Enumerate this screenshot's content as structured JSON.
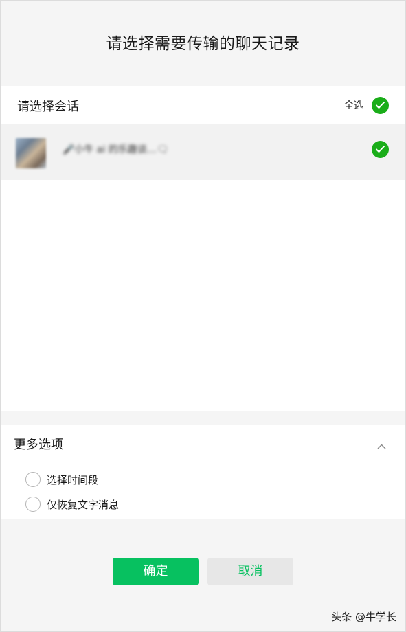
{
  "dialog": {
    "title": "请选择需要传输的聊天记录"
  },
  "sessions": {
    "header_label": "请选择会话",
    "select_all_label": "全选",
    "items": [
      {
        "name": "🎤小牛 ai 的乐趣谈…🗨"
      }
    ]
  },
  "more_options": {
    "header": "更多选项",
    "options": [
      {
        "label": "选择时间段"
      },
      {
        "label": "仅恢复文字消息"
      }
    ]
  },
  "buttons": {
    "confirm": "确定",
    "cancel": "取消"
  },
  "watermark": "头条 @牛学长",
  "colors": {
    "accent": "#07c160",
    "check": "#1aad19"
  },
  "icons": {
    "checked": "check-circle-icon",
    "collapse": "chevron-up-icon"
  }
}
